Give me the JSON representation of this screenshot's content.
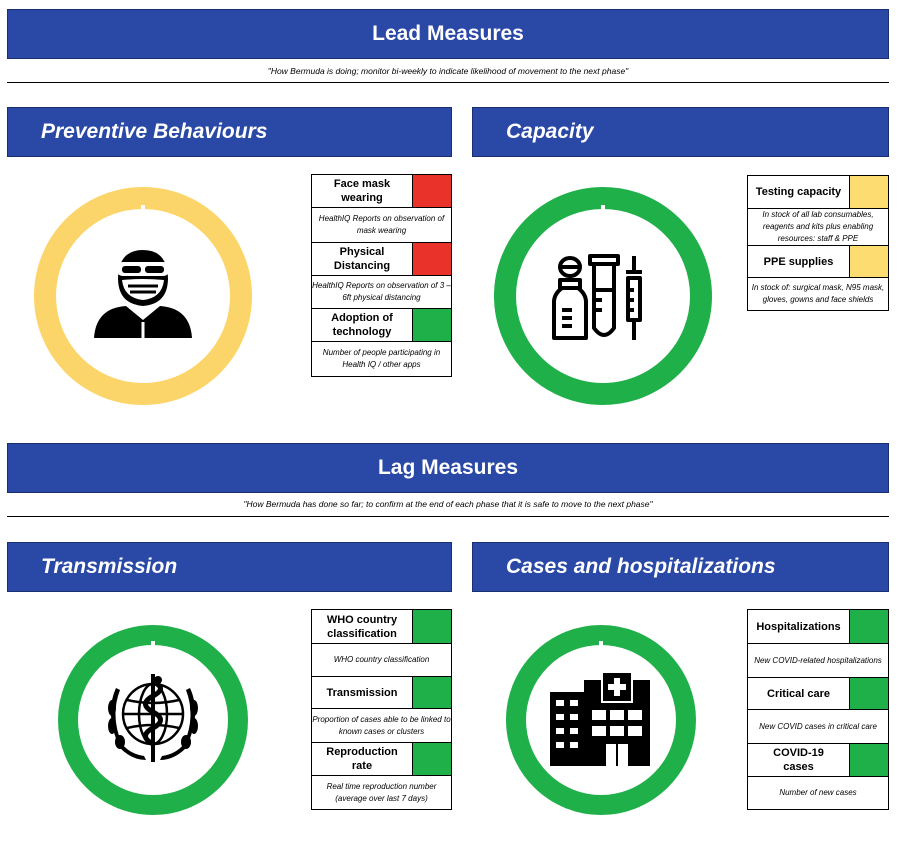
{
  "lead": {
    "title": "Lead Measures",
    "subtitle": "\"How Bermuda is doing; monitor bi-weekly to indicate likelihood of movement to the next phase\""
  },
  "lag": {
    "title": "Lag Measures",
    "subtitle": "\"How Bermuda has done so far; to confirm at the end of each phase that it is safe to move to the next phase\""
  },
  "sections": {
    "preventive": {
      "title": "Preventive Behaviours",
      "ring_color": "#fcd56a",
      "icon": "masked-person-icon",
      "items": [
        {
          "label": "Face mask wearing",
          "status": "red",
          "desc": "HealthIQ Reports on observation of mask wearing"
        },
        {
          "label": "Physical Distancing",
          "status": "red",
          "desc": "HealthIQ Reports on observation of 3 – 6ft physical distancing"
        },
        {
          "label": "Adoption of technology",
          "status": "green",
          "desc": "Number of people participating in Health IQ / other apps"
        }
      ]
    },
    "capacity": {
      "title": "Capacity",
      "ring_color": "#1fb04a",
      "icon": "lab-supplies-icon",
      "items": [
        {
          "label": "Testing capacity",
          "status": "yellow",
          "desc": "In stock of all lab consumables, reagents and kits plus enabling resources: staff & PPE"
        },
        {
          "label": "PPE supplies",
          "status": "yellow",
          "desc": "In stock of: surgical mask, N95 mask, gloves, gowns and face shields"
        }
      ]
    },
    "transmission": {
      "title": "Transmission",
      "ring_color": "#1fb04a",
      "icon": "who-emblem-icon",
      "items": [
        {
          "label": "WHO country classification",
          "status": "green",
          "desc": "WHO country classification"
        },
        {
          "label": "Transmission",
          "status": "green",
          "desc": "Proportion of cases able to be linked to known cases or clusters"
        },
        {
          "label": "Reproduction rate",
          "status": "green",
          "desc": "Real time reproduction number (average over last 7 days)"
        }
      ]
    },
    "cases": {
      "title": "Cases and hospitalizations",
      "ring_color": "#1fb04a",
      "icon": "hospital-building-icon",
      "items": [
        {
          "label": "Hospitalizations",
          "status": "green",
          "desc": "New COVID-related hospitalizations"
        },
        {
          "label": "Critical care",
          "status": "green",
          "desc": "New COVID cases in critical care"
        },
        {
          "label": "COVID-19 cases",
          "status": "green",
          "desc": "Number of new cases"
        }
      ]
    }
  },
  "colors": {
    "banner": "#2a48a5",
    "red": "#e8322a",
    "green": "#1fb04a",
    "yellow": "#fddd72"
  }
}
